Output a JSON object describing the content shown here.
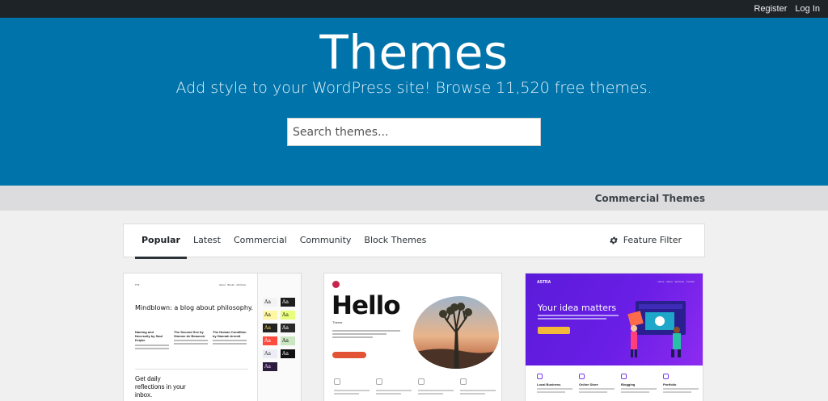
{
  "adminbar": {
    "register_label": "Register",
    "login_label": "Log In"
  },
  "hero": {
    "title": "Themes",
    "subtitle": "Add style to your WordPress site! Browse 11,520 free themes.",
    "search_placeholder": "Search themes..."
  },
  "strip": {
    "commercial_label": "Commercial Themes"
  },
  "filters": {
    "tabs": [
      {
        "label": "Popular",
        "active": true
      },
      {
        "label": "Latest"
      },
      {
        "label": "Commercial"
      },
      {
        "label": "Community"
      },
      {
        "label": "Block Themes"
      }
    ],
    "feature_filter_label": "Feature Filter"
  },
  "cards": {
    "twentytwentythree": {
      "headline": "Mindblown: a blog about philosophy.",
      "columns": [
        "Naming and Necessity by Saul Kripke",
        "The Second Sex by Simone de Beauvoir",
        "The Human Condition by Hannah Arendt"
      ],
      "cta_text": "Get daily reflections in your inbox.",
      "swatch_label": "Aa"
    },
    "hello": {
      "title": "Hello",
      "subtitle": "Theme"
    },
    "astra": {
      "brand": "ASTRA",
      "headline": "Your idea matters",
      "features": [
        "Local Business",
        "Online Store",
        "Blogging",
        "Portfolio"
      ]
    }
  },
  "colors": {
    "hero_bg": "#0073aa",
    "adminbar_bg": "#1d2327",
    "astra_purple": "#6a1ee6",
    "hello_accent": "#e25335"
  }
}
